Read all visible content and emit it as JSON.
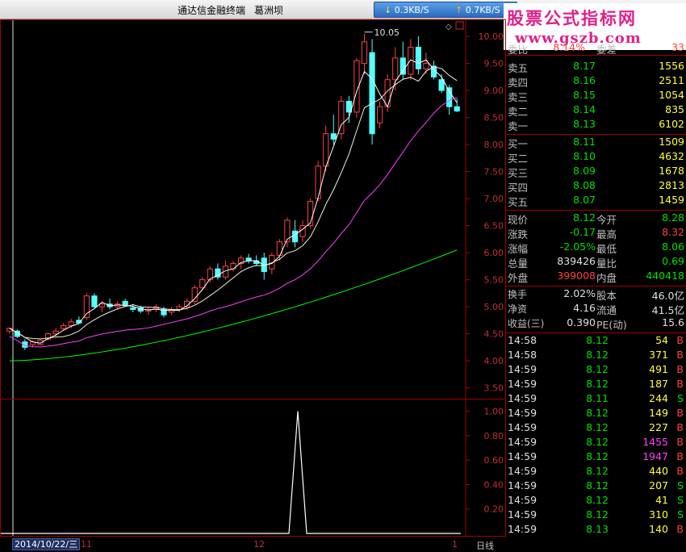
{
  "window": {
    "title": "通达信金融终端",
    "stock": "葛洲坝"
  },
  "network": {
    "download": "0.3KB/S",
    "upload": "0.7KB/S"
  },
  "brand": {
    "line1": "股票公式指标网",
    "line2": "www.gszb.com"
  },
  "colors": {
    "up": "#ff4040",
    "down": "#00e000",
    "ma5": "#ffffff",
    "ma10": "#ffff40",
    "ma20": "#ff40ff",
    "ma60": "#00ff00"
  },
  "chart_data": [
    {
      "type": "candlestick",
      "title": "",
      "y_ticks": [
        "10.00",
        "9.50",
        "9.00",
        "8.50",
        "8.00",
        "7.50",
        "7.00",
        "6.50",
        "6.00",
        "5.50",
        "5.00",
        "4.50",
        "4.00",
        "3.50"
      ],
      "ylim": [
        3.3,
        10.3
      ],
      "high_marker": "10.05",
      "x_ticks": [
        "11",
        "12",
        "1"
      ],
      "candles": [
        [
          4.55,
          4.62,
          4.5,
          4.6
        ],
        [
          4.55,
          4.58,
          4.42,
          4.45
        ],
        [
          4.35,
          4.4,
          4.2,
          4.25
        ],
        [
          4.3,
          4.38,
          4.25,
          4.35
        ],
        [
          4.3,
          4.4,
          4.28,
          4.38
        ],
        [
          4.4,
          4.52,
          4.38,
          4.5
        ],
        [
          4.5,
          4.6,
          4.45,
          4.55
        ],
        [
          4.6,
          4.7,
          4.55,
          4.65
        ],
        [
          4.65,
          4.78,
          4.6,
          4.72
        ],
        [
          4.75,
          4.82,
          4.68,
          4.7
        ],
        [
          4.8,
          5.25,
          4.75,
          5.2
        ],
        [
          5.2,
          5.25,
          4.98,
          5.0
        ],
        [
          5.0,
          5.1,
          4.9,
          5.05
        ],
        [
          5.05,
          5.15,
          4.95,
          5.0
        ],
        [
          5.0,
          5.1,
          4.95,
          5.05
        ],
        [
          5.1,
          5.15,
          5.0,
          5.02
        ],
        [
          4.98,
          5.05,
          4.9,
          4.95
        ],
        [
          4.98,
          5.02,
          4.88,
          4.92
        ],
        [
          4.92,
          5.0,
          4.85,
          4.95
        ],
        [
          4.95,
          5.05,
          4.9,
          5.0
        ],
        [
          4.95,
          5.0,
          4.8,
          4.85
        ],
        [
          4.9,
          5.0,
          4.85,
          4.95
        ],
        [
          4.95,
          5.05,
          4.9,
          5.0
        ],
        [
          5.0,
          5.15,
          4.95,
          5.1
        ],
        [
          5.1,
          5.4,
          5.05,
          5.35
        ],
        [
          5.35,
          5.55,
          5.3,
          5.5
        ],
        [
          5.5,
          5.75,
          5.45,
          5.7
        ],
        [
          5.7,
          5.8,
          5.5,
          5.55
        ],
        [
          5.55,
          5.85,
          5.5,
          5.75
        ],
        [
          5.7,
          5.85,
          5.65,
          5.8
        ],
        [
          5.8,
          5.95,
          5.7,
          5.9
        ],
        [
          5.9,
          5.98,
          5.8,
          5.85
        ],
        [
          5.85,
          5.95,
          5.75,
          5.8
        ],
        [
          5.9,
          6.0,
          5.5,
          5.65
        ],
        [
          5.7,
          6.0,
          5.6,
          5.95
        ],
        [
          5.95,
          6.25,
          5.85,
          6.2
        ],
        [
          6.2,
          6.65,
          6.1,
          6.6
        ],
        [
          6.4,
          6.6,
          6.1,
          6.2
        ],
        [
          6.3,
          6.6,
          6.2,
          6.5
        ],
        [
          6.5,
          7.0,
          6.45,
          6.95
        ],
        [
          7.0,
          7.7,
          6.95,
          7.6
        ],
        [
          7.6,
          8.35,
          7.5,
          8.2
        ],
        [
          8.2,
          8.55,
          8.0,
          8.1
        ],
        [
          8.2,
          8.9,
          8.1,
          8.8
        ],
        [
          8.8,
          8.9,
          8.4,
          8.6
        ],
        [
          8.6,
          9.6,
          8.5,
          9.55
        ],
        [
          9.5,
          10.05,
          9.3,
          9.9
        ],
        [
          9.7,
          9.95,
          8.0,
          8.2
        ],
        [
          8.4,
          8.8,
          8.3,
          8.7
        ],
        [
          8.7,
          9.3,
          8.6,
          9.2
        ],
        [
          9.2,
          9.8,
          9.0,
          9.6
        ],
        [
          9.6,
          9.9,
          9.2,
          9.3
        ],
        [
          9.3,
          9.95,
          9.2,
          9.8
        ],
        [
          9.8,
          10.0,
          9.3,
          9.4
        ],
        [
          9.4,
          9.7,
          9.3,
          9.5
        ],
        [
          9.45,
          9.55,
          9.2,
          9.25
        ],
        [
          9.2,
          9.3,
          8.95,
          9.0
        ],
        [
          9.05,
          9.1,
          8.55,
          8.7
        ],
        [
          8.7,
          8.85,
          8.6,
          8.62
        ]
      ]
    },
    {
      "type": "line",
      "title": "",
      "y_ticks": [
        "1.00",
        "0.80",
        "0.60",
        "0.40",
        "0.20"
      ],
      "ylim": [
        0,
        1.05
      ],
      "peak": 1.0
    }
  ],
  "quote": {
    "top_row": {
      "l1": "委比",
      "v1": "8.14%",
      "l2": "委差",
      "v2": "33"
    },
    "sell": [
      {
        "label": "卖五",
        "price": "8.17",
        "vol": "1556"
      },
      {
        "label": "卖四",
        "price": "8.16",
        "vol": "2511"
      },
      {
        "label": "卖三",
        "price": "8.15",
        "vol": "1054"
      },
      {
        "label": "卖二",
        "price": "8.14",
        "vol": "835"
      },
      {
        "label": "卖一",
        "price": "8.13",
        "vol": "6102"
      }
    ],
    "buy": [
      {
        "label": "买一",
        "price": "8.11",
        "vol": "1509"
      },
      {
        "label": "买二",
        "price": "8.10",
        "vol": "4632"
      },
      {
        "label": "买三",
        "price": "8.09",
        "vol": "1678"
      },
      {
        "label": "买四",
        "price": "8.08",
        "vol": "2813"
      },
      {
        "label": "买五",
        "price": "8.07",
        "vol": "1459"
      }
    ],
    "stats": [
      {
        "l1": "现价",
        "v1": "8.12",
        "c1": "green",
        "l2": "今开",
        "v2": "8.28",
        "c2": "green"
      },
      {
        "l1": "涨跌",
        "v1": "-0.17",
        "c1": "green",
        "l2": "最高",
        "v2": "8.32",
        "c2": "red"
      },
      {
        "l1": "涨幅",
        "v1": "-2.05%",
        "c1": "green",
        "l2": "最低",
        "v2": "8.06",
        "c2": "green"
      },
      {
        "l1": "总量",
        "v1": "839426",
        "c1": "white",
        "l2": "量比",
        "v2": "0.69",
        "c2": "green"
      },
      {
        "l1": "外盘",
        "v1": "399008",
        "c1": "red",
        "l2": "内盘",
        "v2": "440418",
        "c2": "green"
      }
    ],
    "fund": [
      {
        "l1": "换手",
        "v1": "2.02%",
        "l2": "股本",
        "v2": "46.0亿"
      },
      {
        "l1": "净资",
        "v1": "4.16",
        "l2": "流通",
        "v2": "41.5亿"
      },
      {
        "l1": "收益(三)",
        "v1": "0.390",
        "l2": "PE(动)",
        "v2": "15.6"
      }
    ],
    "ticks": [
      {
        "t": "14:58",
        "p": "8.12",
        "v": "54",
        "s": "B"
      },
      {
        "t": "14:58",
        "p": "8.12",
        "v": "371",
        "s": "B"
      },
      {
        "t": "14:59",
        "p": "8.12",
        "v": "491",
        "s": "B"
      },
      {
        "t": "14:59",
        "p": "8.12",
        "v": "187",
        "s": "B"
      },
      {
        "t": "14:59",
        "p": "8.11",
        "v": "244",
        "s": "S"
      },
      {
        "t": "14:59",
        "p": "8.12",
        "v": "149",
        "s": "B"
      },
      {
        "t": "14:59",
        "p": "8.12",
        "v": "227",
        "s": "B"
      },
      {
        "t": "14:59",
        "p": "8.12",
        "v": "1455",
        "s": "B"
      },
      {
        "t": "14:59",
        "p": "8.12",
        "v": "1947",
        "s": "B"
      },
      {
        "t": "14:59",
        "p": "8.12",
        "v": "440",
        "s": "B"
      },
      {
        "t": "14:59",
        "p": "8.12",
        "v": "207",
        "s": "S"
      },
      {
        "t": "14:59",
        "p": "8.12",
        "v": "41",
        "s": "S"
      },
      {
        "t": "14:59",
        "p": "8.12",
        "v": "310",
        "s": "S"
      },
      {
        "t": "14:59",
        "p": "8.13",
        "v": "140",
        "s": "B"
      }
    ]
  },
  "bottom": {
    "date": "2014/10/22/三",
    "period": "日线"
  }
}
